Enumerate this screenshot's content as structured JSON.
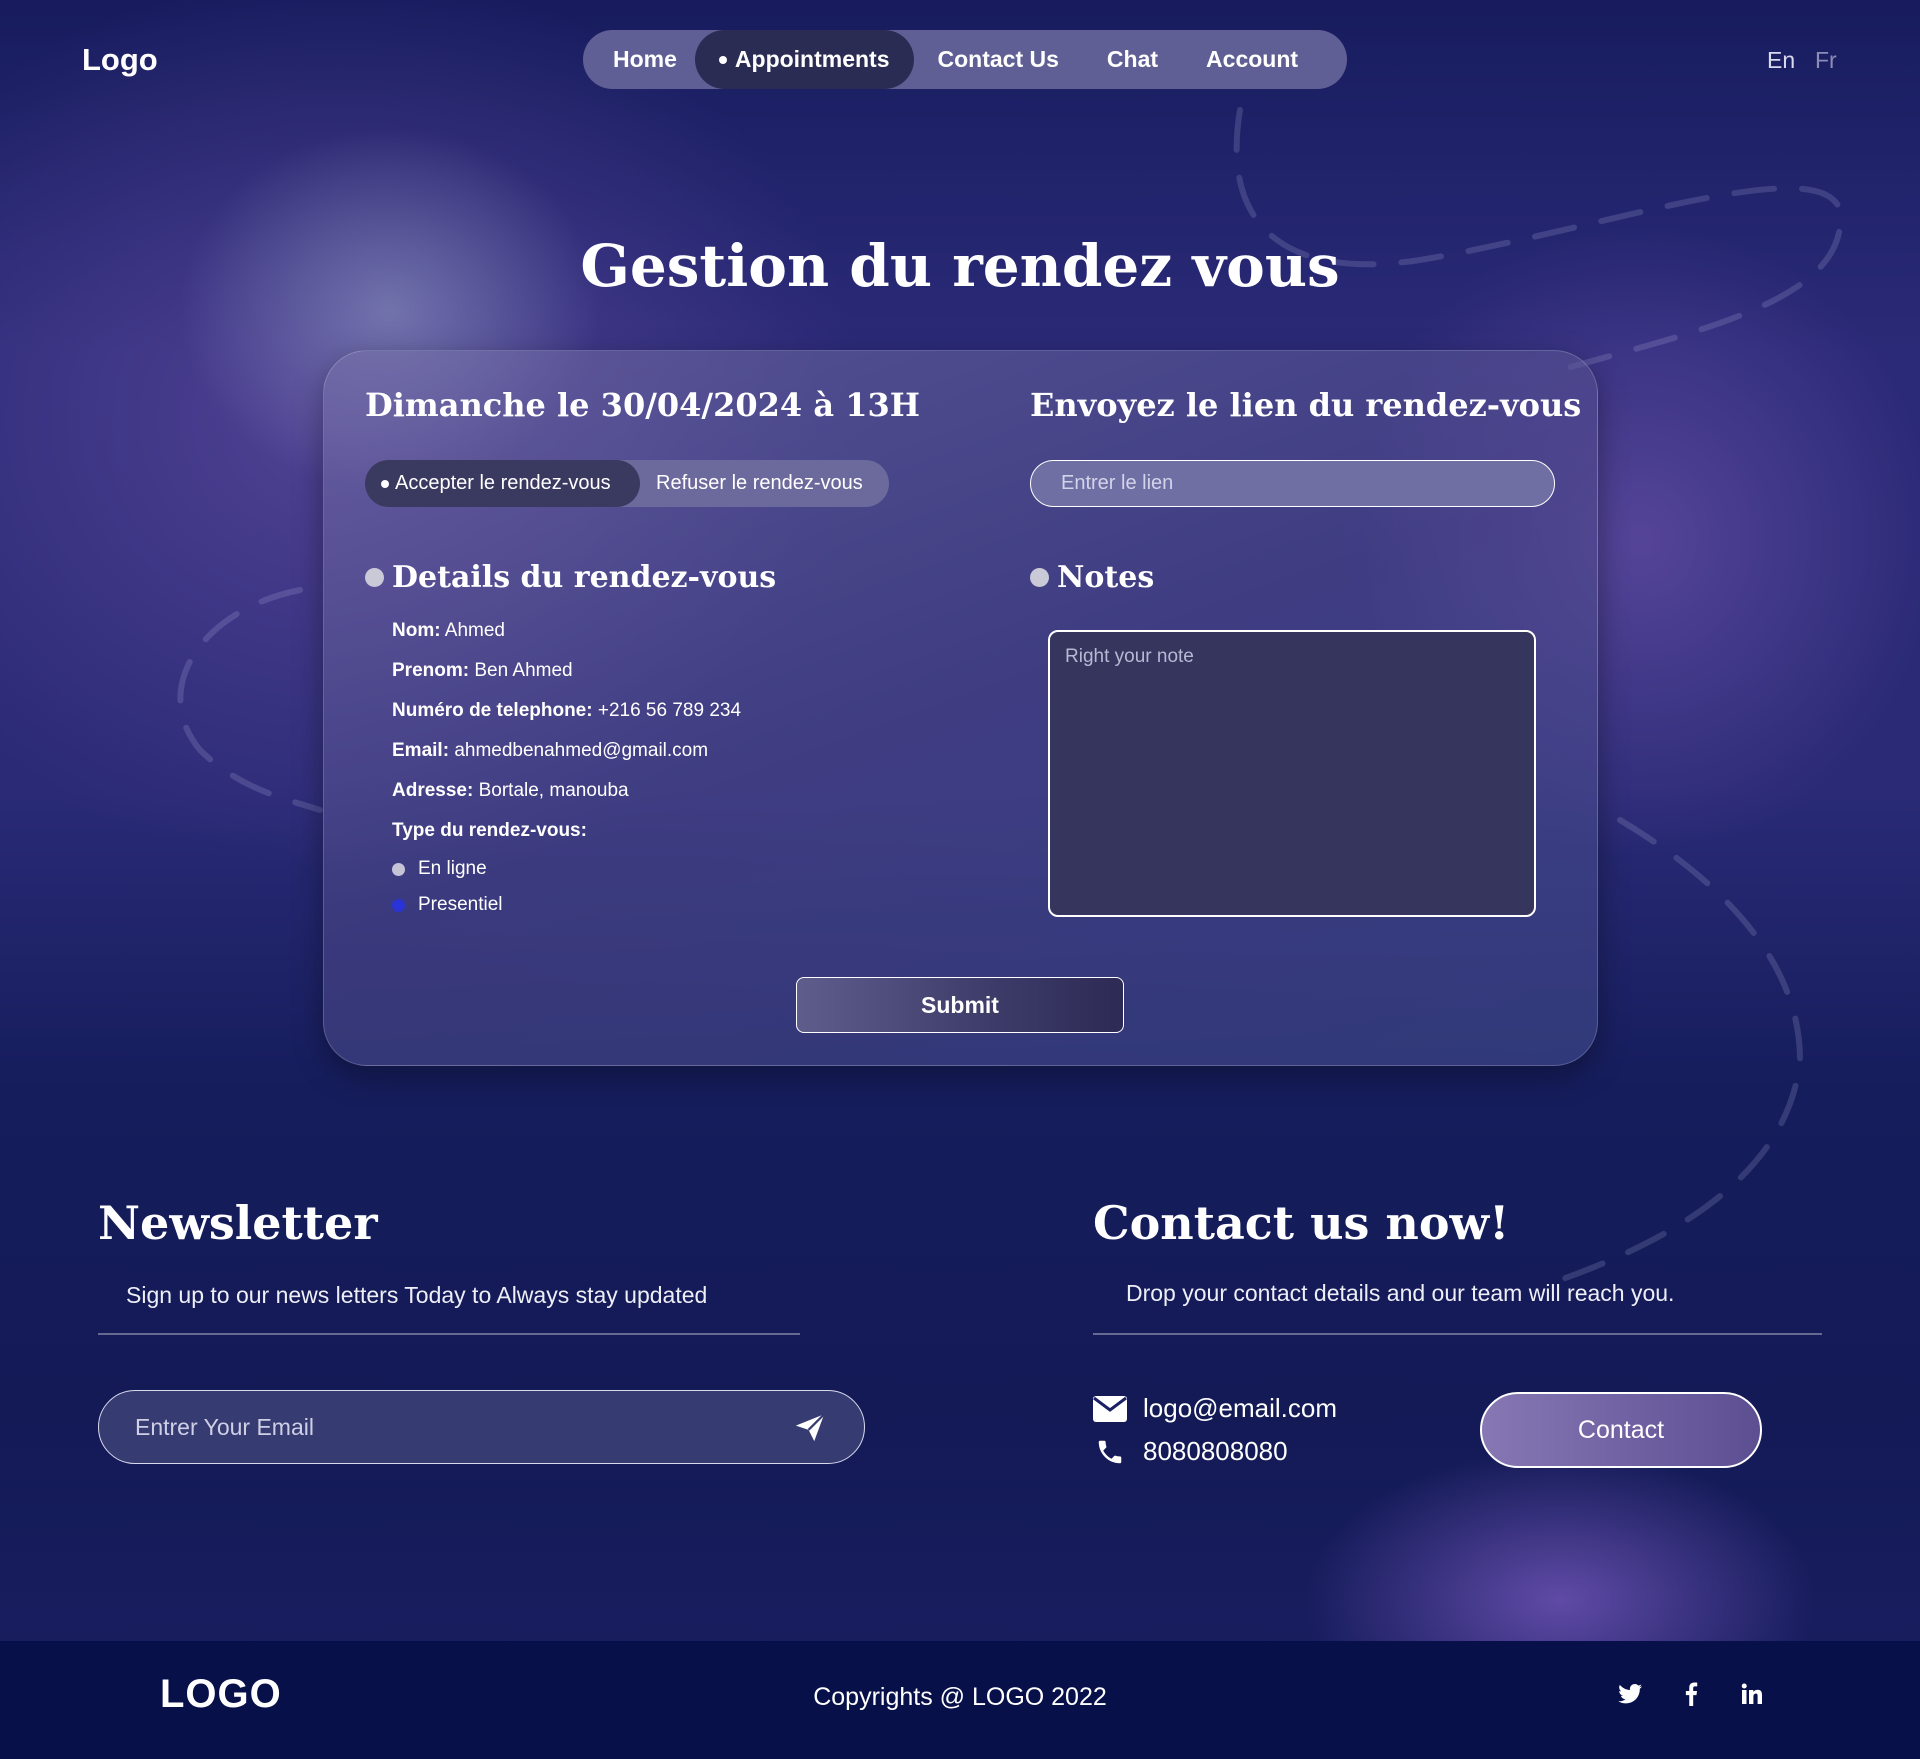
{
  "header": {
    "logo": "Logo",
    "nav": [
      {
        "label": "Home",
        "active": false
      },
      {
        "label": "Appointments",
        "active": true
      },
      {
        "label": "Contact Us",
        "active": false
      },
      {
        "label": "Chat",
        "active": false
      },
      {
        "label": "Account",
        "active": false
      }
    ],
    "languages": [
      "En",
      "Fr"
    ]
  },
  "page_title": "Gestion du rendez vous",
  "card": {
    "date_heading": "Dimanche le 30/04/2024 à 13H",
    "toggle": {
      "accept_label": "Accepter le rendez-vous",
      "refuse_label": "Refuser le rendez-vous",
      "selected": "accept"
    },
    "link_heading": "Envoyez le lien du rendez-vous",
    "link_input": {
      "placeholder": "Entrer le lien",
      "value": ""
    },
    "details_heading": "Details du rendez-vous",
    "details": [
      {
        "label": "Nom:",
        "value": "Ahmed"
      },
      {
        "label": "Prenom:",
        "value": "Ben Ahmed"
      },
      {
        "label": "Numéro de telephone:",
        "value": "+216 56 789 234"
      },
      {
        "label": "Email:",
        "value": "ahmedbenahmed@gmail.com"
      },
      {
        "label": "Adresse:",
        "value": "Bortale, manouba"
      }
    ],
    "type_label": "Type du rendez-vous:",
    "type_options": [
      {
        "label": "En ligne",
        "color": "#c4c4d6",
        "selected": false
      },
      {
        "label": "Presentiel",
        "color": "#2a33d6",
        "selected": true
      }
    ],
    "notes_heading": "Notes",
    "notes": {
      "placeholder": "Right your note",
      "value": ""
    },
    "submit_label": "Submit"
  },
  "newsletter": {
    "heading": "Newsletter",
    "subtitle": "Sign up to our news letters Today to Always stay updated",
    "email_input": {
      "placeholder": "Entrer Your Email",
      "value": ""
    },
    "send_icon": "paper-plane-icon"
  },
  "contact": {
    "heading": "Contact us now!",
    "subtitle": "Drop your contact details and our team will reach you.",
    "email": "logo@email.com",
    "phone": "8080808080",
    "button_label": "Contact"
  },
  "footer": {
    "logo": "LOGO",
    "copyright": "Copyrights @ LOGO 2022",
    "social": [
      "twitter-icon",
      "facebook-icon",
      "linkedin-icon"
    ]
  },
  "colors": {
    "background": "#1b1f63",
    "nav_pill": "#5f5f95",
    "nav_active": "#2b2c53",
    "footer": "#08104a",
    "presentiel_radio": "#2a33d6"
  }
}
